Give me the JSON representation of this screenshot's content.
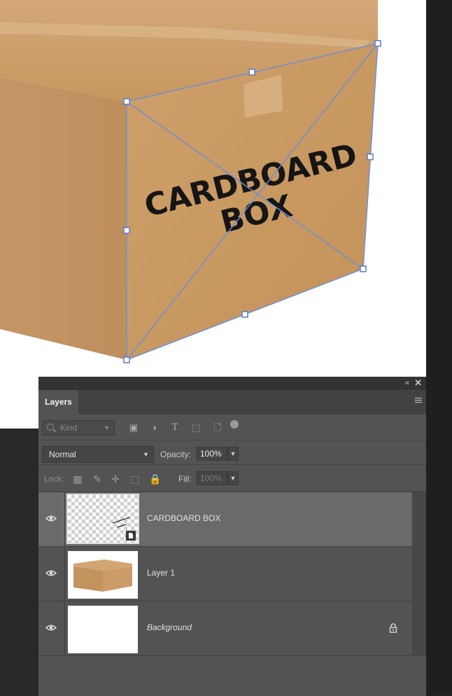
{
  "document": {
    "box_text_line1": "CARDBOARD",
    "box_text_line2": "BOX"
  },
  "panel": {
    "tab_label": "Layers",
    "filter": {
      "kind_placeholder": "Kind"
    },
    "blend": {
      "mode": "Normal",
      "opacity_label": "Opacity:",
      "opacity_value": "100%",
      "fill_label": "Fill:",
      "fill_value": "100%",
      "lock_label": "Lock:"
    },
    "layers": [
      {
        "name": "CARDBOARD BOX",
        "selected": true,
        "visible": true,
        "type": "smart-object"
      },
      {
        "name": "Layer 1",
        "selected": false,
        "visible": true,
        "type": "image"
      },
      {
        "name": "Background",
        "selected": false,
        "visible": true,
        "type": "background",
        "locked": true
      }
    ]
  },
  "colors": {
    "panel_bg": "#535353",
    "selected_layer": "#6a6a6a",
    "cardboard": "#c99c66",
    "transform_handles": "#6f8fd6"
  }
}
